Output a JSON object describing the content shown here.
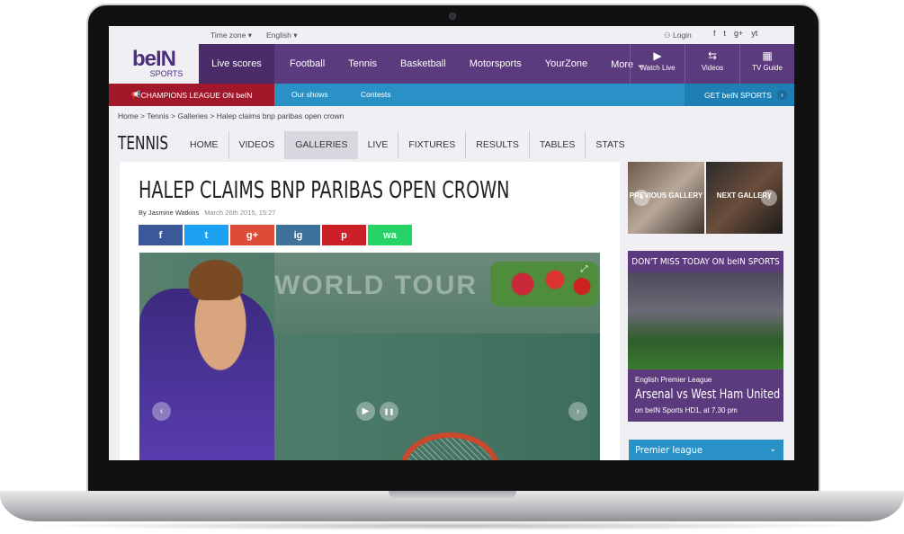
{
  "topbar": {
    "timezone": "Time zone ▾",
    "language": "English ▾",
    "login": "Login",
    "social": [
      "f",
      "t",
      "g+",
      "yt"
    ]
  },
  "brand": {
    "logo_main": "beIN",
    "logo_sub": "SPORTS"
  },
  "nav": {
    "live_scores": "Live scores",
    "items": [
      "Football",
      "Tennis",
      "Basketball",
      "Motorsports",
      "YourZone",
      "More ⌄"
    ],
    "tools": [
      {
        "icon": "▶",
        "label": "Watch Live"
      },
      {
        "icon": "⇆",
        "label": "Videos"
      },
      {
        "icon": "▦",
        "label": "TV Guide"
      }
    ]
  },
  "subnav": {
    "champions": "CHAMPIONS LEAGUE ON beIN",
    "shows": "Our shows",
    "contests": "Contests",
    "get": "GET beIN SPORTS",
    "get_arrow": "›"
  },
  "breadcrumb": "Home > Tennis > Galleries > Halep claims bnp paribas open crown",
  "section": {
    "title": "TENNIS",
    "tabs": [
      "HOME",
      "VIDEOS",
      "GALLERIES",
      "LIVE",
      "FIXTURES",
      "RESULTS",
      "TABLES",
      "STATS"
    ],
    "selected": "GALLERIES"
  },
  "article": {
    "headline": "HALEP CLAIMS BNP PARIBAS OPEN CROWN",
    "author": "By Jasmine Watkins",
    "date": "March 26th 2015, 15:27",
    "share": [
      {
        "icon": "f",
        "color": "#3b5998"
      },
      {
        "icon": "t",
        "color": "#1da1f2"
      },
      {
        "icon": "g+",
        "color": "#dd4b39"
      },
      {
        "icon": "ig",
        "color": "#3f729b"
      },
      {
        "icon": "p",
        "color": "#cb2027"
      },
      {
        "icon": "wa",
        "color": "#25d366"
      }
    ],
    "photo_text": "WORLD TOUR",
    "controls": {
      "prev": "‹",
      "play": "▶",
      "pause": "❚❚",
      "next": "›",
      "expand": "⤢"
    }
  },
  "sidebar": {
    "gallery": {
      "prev_label": "PREVIOUS GALLERY",
      "next_label": "NEXT GALLERY",
      "prev_arrow": "‹",
      "next_arrow": "›"
    },
    "dont_miss": {
      "header": "DON'T MISS TODAY ON beIN SPORTS",
      "kicker": "English Premier League",
      "match": "Arsenal vs West Ham United",
      "when": "on beIN Sports HD1, at 7.30 pm"
    },
    "league": {
      "label": "Premier league",
      "chevron": "⌄"
    }
  }
}
